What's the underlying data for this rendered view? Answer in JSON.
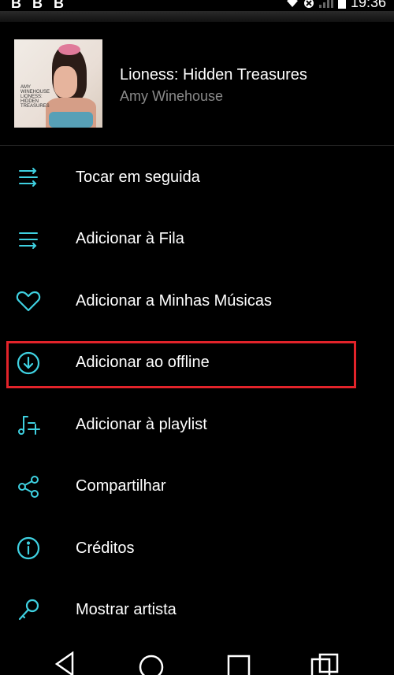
{
  "status_bar": {
    "left_icons": [
      "B",
      "B",
      "B"
    ],
    "time": "19:36"
  },
  "header": {
    "album_title": "Lioness: Hidden Treasures",
    "artist": "Amy Winehouse",
    "album_art_text": [
      "AMY",
      "WINEHOUSE",
      "LIONESS:",
      "HIDDEN",
      "TREASURES"
    ]
  },
  "menu": {
    "items": [
      {
        "label": "Tocar em seguida",
        "icon": "play-next-icon"
      },
      {
        "label": "Adicionar à Fila",
        "icon": "add-to-queue-icon"
      },
      {
        "label": "Adicionar a Minhas Músicas",
        "icon": "heart-icon"
      },
      {
        "label": "Adicionar ao offline",
        "icon": "download-circle-icon",
        "highlighted": true
      },
      {
        "label": "Adicionar à playlist",
        "icon": "add-to-playlist-icon"
      },
      {
        "label": "Compartilhar",
        "icon": "share-icon"
      },
      {
        "label": "Créditos",
        "icon": "info-icon"
      },
      {
        "label": "Mostrar artista",
        "icon": "microphone-icon"
      }
    ]
  },
  "nav_bar": {
    "buttons": [
      "back-icon",
      "home-icon",
      "recents-icon",
      "switch-icon"
    ]
  },
  "colors": {
    "accent": "#3fd1e1",
    "highlight_border": "#e2232a",
    "background": "#000000",
    "secondary_text": "#8a8a8a"
  }
}
